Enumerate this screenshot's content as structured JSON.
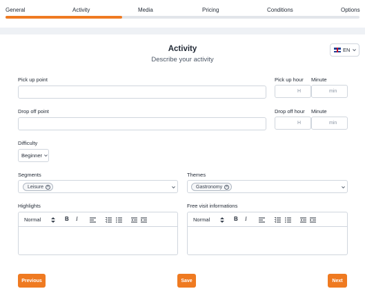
{
  "stepper": {
    "steps": [
      "General",
      "Activity",
      "Media",
      "Pricing",
      "Conditions",
      "Options"
    ],
    "active_index": 1,
    "progress_fraction": 0.33
  },
  "header": {
    "title": "Activity",
    "subtitle": "Describe your activity",
    "language": "EN"
  },
  "form": {
    "pickup_point": {
      "label": "Pick up point",
      "value": ""
    },
    "pickup_hour": {
      "label": "Pick up hour",
      "placeholder": "H"
    },
    "pickup_minute": {
      "label": "Minute",
      "placeholder": "min"
    },
    "dropoff_point": {
      "label": "Drop off point",
      "value": ""
    },
    "dropoff_hour": {
      "label": "Drop off hour",
      "placeholder": "H"
    },
    "dropoff_minute": {
      "label": "Minute",
      "placeholder": "min"
    },
    "difficulty": {
      "label": "Difficulty",
      "value": "Beginner"
    },
    "segments": {
      "label": "Segments",
      "chips": [
        "Leisure"
      ]
    },
    "themes": {
      "label": "Themes",
      "chips": [
        "Gastronomy"
      ]
    },
    "highlights": {
      "label": "Highlights",
      "format": "Normal"
    },
    "free_visit": {
      "label": "Free visit informations",
      "format": "Normal"
    }
  },
  "toolbar": {
    "bold": "B",
    "italic": "I"
  },
  "actions": {
    "previous": "Previous",
    "save": "Save",
    "next": "Next"
  },
  "colors": {
    "accent": "#ef7a21",
    "track": "#e2e5ea",
    "border": "#cfd5dd"
  }
}
